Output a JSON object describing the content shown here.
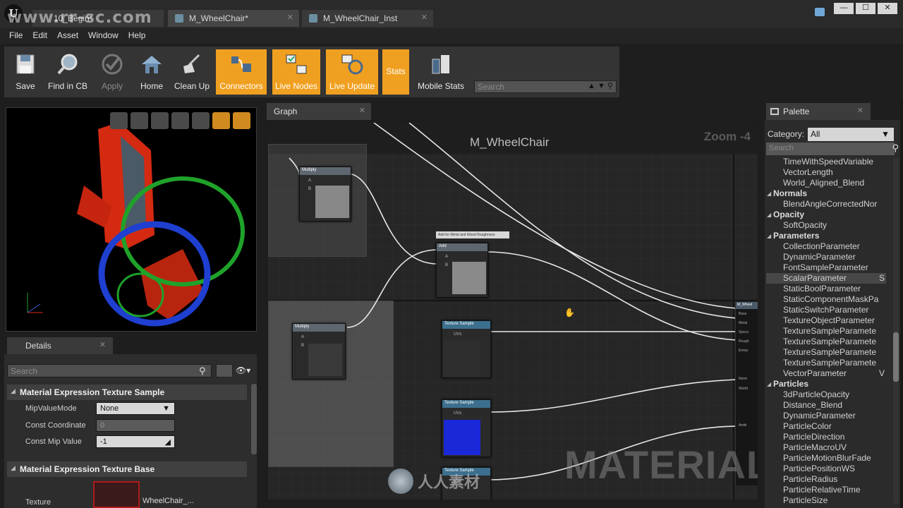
{
  "window": {
    "watermark": "www.rr-sc.com",
    "tabs": [
      {
        "label": "10_Begin*"
      },
      {
        "label": "M_WheelChair*"
      },
      {
        "label": "M_WheelChair_Inst"
      }
    ],
    "controls": {
      "minimize": "—",
      "maximize": "☐",
      "close": "✕"
    }
  },
  "menu": [
    "File",
    "Edit",
    "Asset",
    "Window",
    "Help"
  ],
  "toolbar": {
    "save": "Save",
    "find_in_cb": "Find in CB",
    "apply": "Apply",
    "home": "Home",
    "clean_up": "Clean Up",
    "connectors": "Connectors",
    "live_nodes": "Live Nodes",
    "live_update": "Live Update",
    "stats": "Stats",
    "mobile_stats": "Mobile Stats",
    "search_placeholder": "Search",
    "colors": {
      "highlight": "#f0a020"
    }
  },
  "details": {
    "tab_label": "Details",
    "search_placeholder": "Search",
    "section1": "Material Expression Texture Sample",
    "props": [
      {
        "label": "MipValueMode",
        "value": "None"
      },
      {
        "label": "Const Coordinate",
        "value": "0"
      },
      {
        "label": "Const Mip Value",
        "value": "-1"
      }
    ],
    "section2": "Material Expression Texture Base",
    "texture_label": "Texture",
    "texture_value": "WheelChair_..."
  },
  "graph": {
    "tab_label": "Graph",
    "title": "M_WheelChair",
    "zoom": "Zoom -4",
    "watermark": "MATERIAL",
    "nodes": {
      "multiply_top": "Multiply",
      "multiply_bottom": "Multiply",
      "add": "Add",
      "add_comment": "Add for Metal and Wood Roughness",
      "texture_sample": "Texture Sample",
      "uvs": "UVs",
      "pin_a": "A",
      "pin_b": "B"
    },
    "result_node": {
      "title": "M_Wheel",
      "pins": [
        "Base",
        "Metal",
        "Specu",
        "Rough",
        "Emiss",
        "Norm",
        "World",
        "Ambi"
      ]
    },
    "logo_text": "人人素材"
  },
  "palette": {
    "tab_label": "Palette",
    "category_label": "Category:",
    "category_value": "All",
    "search_placeholder": "Search",
    "items": [
      {
        "label": "TimeWithSpeedVariable",
        "type": "item"
      },
      {
        "label": "VectorLength",
        "type": "item"
      },
      {
        "label": "World_Aligned_Blend",
        "type": "item"
      },
      {
        "label": "Normals",
        "type": "cat"
      },
      {
        "label": "BlendAngleCorrectedNor",
        "type": "item"
      },
      {
        "label": "Opacity",
        "type": "cat"
      },
      {
        "label": "SoftOpacity",
        "type": "item"
      },
      {
        "label": "Parameters",
        "type": "cat"
      },
      {
        "label": "CollectionParameter",
        "type": "item"
      },
      {
        "label": "DynamicParameter",
        "type": "item"
      },
      {
        "label": "FontSampleParameter",
        "type": "item"
      },
      {
        "label": "ScalarParameter",
        "type": "sel",
        "suffix": "S"
      },
      {
        "label": "StaticBoolParameter",
        "type": "item"
      },
      {
        "label": "StaticComponentMaskPa",
        "type": "item"
      },
      {
        "label": "StaticSwitchParameter",
        "type": "item"
      },
      {
        "label": "TextureObjectParameter",
        "type": "item"
      },
      {
        "label": "TextureSampleParamete",
        "type": "item"
      },
      {
        "label": "TextureSampleParamete",
        "type": "item"
      },
      {
        "label": "TextureSampleParamete",
        "type": "item"
      },
      {
        "label": "TextureSampleParamete",
        "type": "item"
      },
      {
        "label": "VectorParameter",
        "type": "item",
        "suffix": "V"
      },
      {
        "label": "Particles",
        "type": "cat"
      },
      {
        "label": "3dParticleOpacity",
        "type": "item"
      },
      {
        "label": "Distance_Blend",
        "type": "item"
      },
      {
        "label": "DynamicParameter",
        "type": "item"
      },
      {
        "label": "ParticleColor",
        "type": "item"
      },
      {
        "label": "ParticleDirection",
        "type": "item"
      },
      {
        "label": "ParticleMacroUV",
        "type": "item"
      },
      {
        "label": "ParticleMotionBlurFade",
        "type": "item"
      },
      {
        "label": "ParticlePositionWS",
        "type": "item"
      },
      {
        "label": "ParticleRadius",
        "type": "item"
      },
      {
        "label": "ParticleRelativeTime",
        "type": "item"
      },
      {
        "label": "ParticleSize",
        "type": "item"
      }
    ]
  }
}
